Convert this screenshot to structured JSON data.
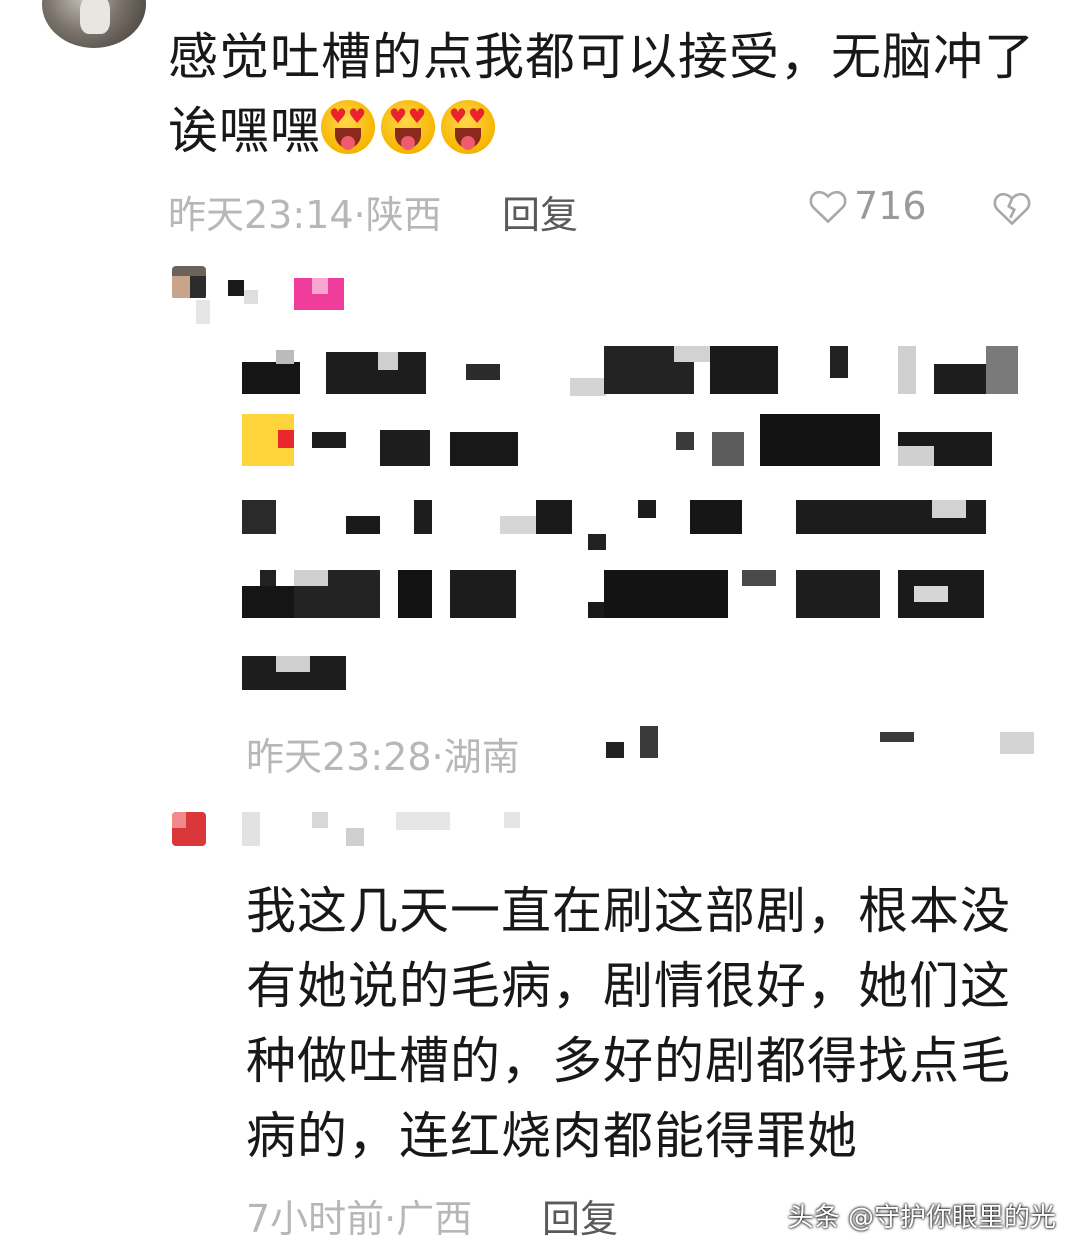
{
  "comments": [
    {
      "line1": "感觉吐槽的点我都可以接受，无脑冲了",
      "line2": "诶嘿嘿",
      "meta": "昨天23:14·陕西",
      "reply_label": "回复",
      "likes": "716",
      "emoji_count": 3
    },
    {
      "meta": "昨天23:28·湖南"
    },
    {
      "lines": [
        "我这几天一直在刷这部剧，根本没",
        "有她说的毛病，剧情很好，她们这",
        "种做吐槽的，多好的剧都得找点毛",
        "病的，连红烧肉都能得罪她"
      ],
      "meta": "7小时前·广西",
      "reply_label": "回复"
    }
  ],
  "watermark": "头条 @守护你眼里的光"
}
